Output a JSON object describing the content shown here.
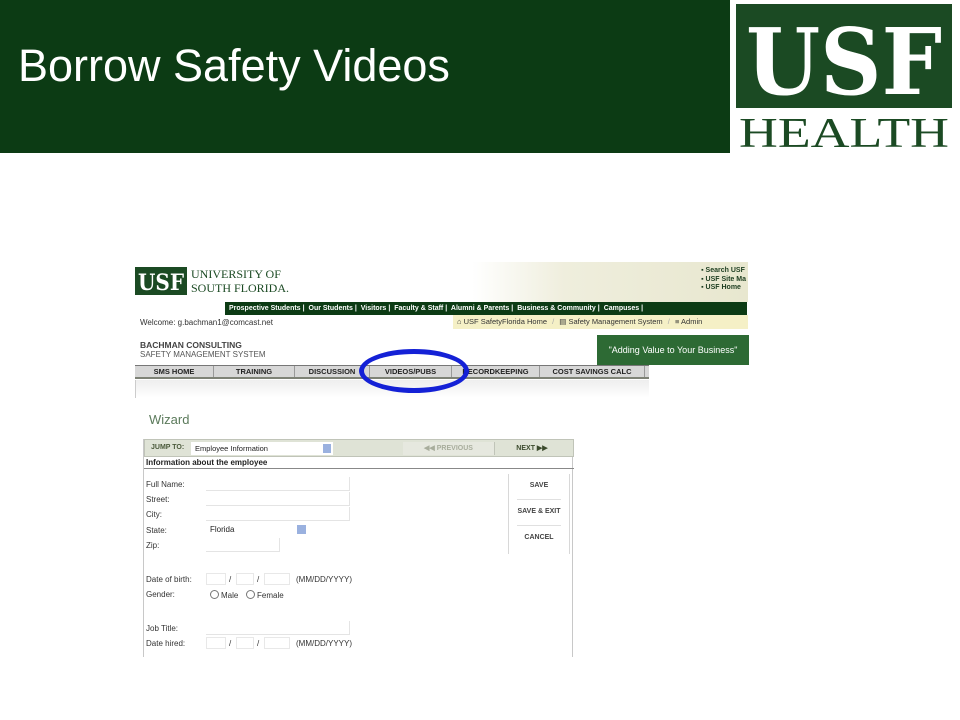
{
  "slide": {
    "title": "Borrow Safety Videos",
    "logo": {
      "top": "USF",
      "bottom": "HEALTH"
    },
    "colors": {
      "header_green": "#0c3b14",
      "logo_green": "#1b4a23",
      "highlight_blue": "#1421d6"
    }
  },
  "usf_site": {
    "university_logo": {
      "mark": "USF",
      "line1": "UNIVERSITY OF",
      "line2": "SOUTH FLORIDA."
    },
    "top_links": [
      "Search USF",
      "USF Site Ma",
      "USF Home"
    ],
    "nav_links": [
      "Prospective Students",
      "Our Students",
      "Visitors",
      "Faculty & Staff",
      "Alumni & Parents",
      "Business & Community",
      "Campuses"
    ],
    "welcome": "Welcome: g.bachman1@comcast.net",
    "breadcrumb": [
      "USF SafetyFlorida Home",
      "Safety Management System",
      "Admin"
    ]
  },
  "sms": {
    "company": "BACHMAN CONSULTING",
    "system": "SAFETY MANAGEMENT SYSTEM",
    "tagline": "\"Adding Value to Your Business\"",
    "tabs": [
      "SMS HOME",
      "TRAINING",
      "DISCUSSION",
      "VIDEOS/PUBS",
      "RECORDKEEPING",
      "COST SAVINGS CALC"
    ],
    "highlighted_tab": "VIDEOS/PUBS"
  },
  "wizard": {
    "title": "Wizard",
    "jump_label": "JUMP TO:",
    "jump_value": "Employee Information",
    "previous": "PREVIOUS",
    "next": "NEXT",
    "section_heading": "Information about the employee",
    "fields": {
      "full_name": "Full Name:",
      "street": "Street:",
      "city": "City:",
      "state": "State:",
      "state_value": "Florida",
      "zip": "Zip:",
      "dob": "Date of birth:",
      "date_format": "(MM/DD/YYYY)",
      "gender": "Gender:",
      "male": "Male",
      "female": "Female",
      "job_title": "Job Title:",
      "date_hired": "Date hired:"
    },
    "actions": [
      "SAVE",
      "SAVE & EXIT",
      "CANCEL"
    ]
  }
}
